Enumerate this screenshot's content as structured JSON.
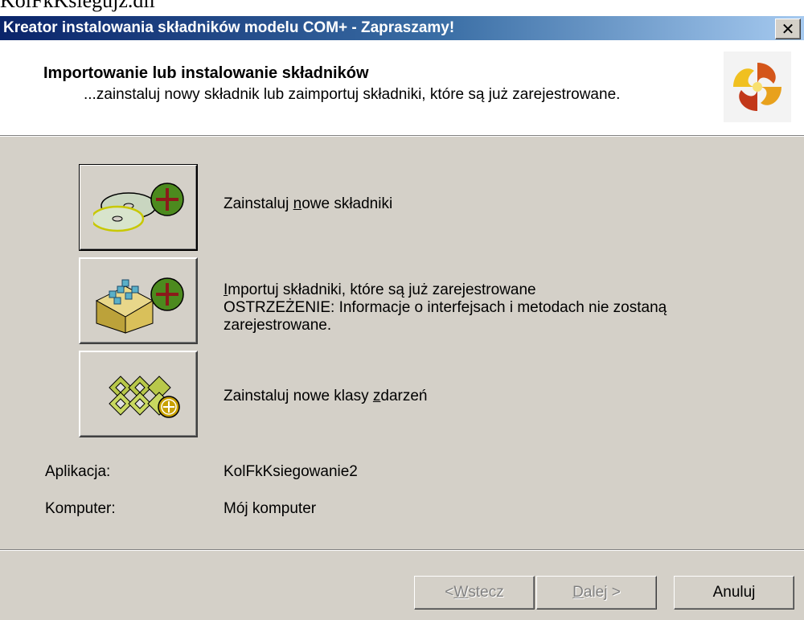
{
  "background_text": "KolFkKsiegujz.dll",
  "window": {
    "title": "Kreator instalowania składników modelu COM+ - Zapraszamy!",
    "close_symbol": "✕"
  },
  "header": {
    "title": "Importowanie lub instalowanie składników",
    "subtitle": "...zainstaluj nowy składnik lub zaimportuj składniki, które są już zarejestrowane.",
    "logo_icon": "com-plus-wizard-logo-icon"
  },
  "options": [
    {
      "label_pre": "Zainstaluj ",
      "label_key": "n",
      "label_post": "owe składniki",
      "icon": "install-components-cd-icon"
    },
    {
      "label_pre": "",
      "label_key": "I",
      "label_post": "mportuj składniki, które są już zarejestrowane",
      "warning": "OSTRZEŻENIE: Informacje o interfejsach i metodach nie zostaną zarejestrowane.",
      "icon": "import-components-box-icon"
    },
    {
      "label_pre": "Zainstaluj nowe klasy ",
      "label_key": "z",
      "label_post": "darzeń",
      "icon": "install-event-classes-icon"
    }
  ],
  "fields": {
    "application_label": "Aplikacja:",
    "application_value": "KolFkKsiegowanie2",
    "computer_label": "Komputer:",
    "computer_value": "Mój komputer"
  },
  "buttons": {
    "back_pre": "< ",
    "back_key": "W",
    "back_post": "stecz",
    "next_key": "D",
    "next_post": "alej >",
    "cancel": "Anuluj"
  },
  "colors": {
    "titlebar_start": "#0a246a",
    "titlebar_end": "#a6caf0",
    "dialog_face": "#d4d0c8"
  }
}
